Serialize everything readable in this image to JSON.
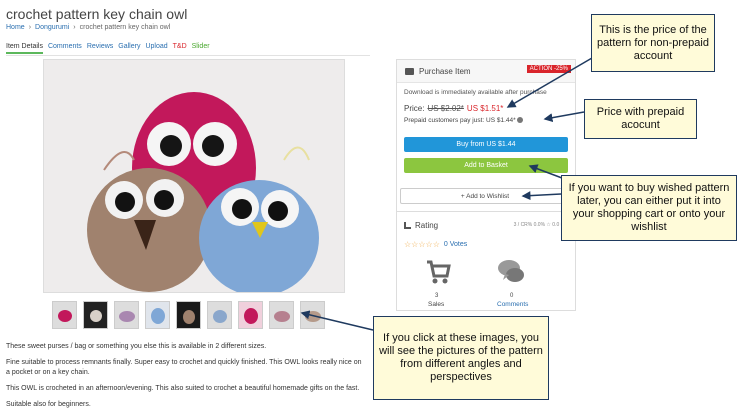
{
  "header": {
    "title": "crochet pattern key chain owl",
    "breadcrumb": [
      "Home",
      "Dongurumi",
      "crochet pattern key chain owl"
    ],
    "breadcrumb_sep": "›"
  },
  "tabs": [
    {
      "label": "Item Details"
    },
    {
      "label": "Comments"
    },
    {
      "label": "Reviews"
    },
    {
      "label": "Gallery"
    },
    {
      "label": "Upload"
    },
    {
      "label": "T&D"
    },
    {
      "label": "Slider"
    }
  ],
  "purchase": {
    "heading": "Purchase Item",
    "badge": "ACTION -25%",
    "download_note": "Download is immediately available after purchase",
    "price_label": "Price:",
    "old_price": "US $2.02*",
    "new_price": "US $1.51*",
    "prepaid_note": "Prepaid customers pay just: US $1.44*",
    "buy_button": "Buy from US $1.44",
    "basket_button": "Add to Basket",
    "wishlist_button": "+ Add to Wishlist"
  },
  "rating": {
    "heading": "Rating",
    "stats": "3 / CR% 0.0%  ☆ 0.0  ✉ 0",
    "stars": "☆☆☆☆☆",
    "votes": "0 Votes",
    "sales_count": "3",
    "sales_label": "Sales",
    "comments_count": "0",
    "comments_label": "Comments"
  },
  "description": [
    "These sweet purses / bag or something you else this is available in 2 different sizes.",
    "Fine suitable to process remnants finally. Super easy to crochet and quickly finished. This OWL looks really nice on a pocket or on a key chain.",
    "This OWL is crocheted in an afternoon/evening. This also suited to crochet a beautiful homemade gifts on the fast.",
    "Suitable also for beginners."
  ],
  "callouts": {
    "c1": "This is the price of the pattern for non-prepaid account",
    "c2": "Price with prepaid acocunt",
    "c3": "If you want to buy wished pattern later, you can either put it into your shopping cart or onto your wishlist",
    "c4": "If you click at these images, you will see the pictures of the pattern from different angles and perspectives"
  },
  "colors": {
    "buy": "#2196d9",
    "basket": "#8cc63f",
    "action_badge": "#d9252b",
    "callout_bg": "#fffbd9",
    "callout_border": "#1f3a5f"
  },
  "icons": [
    "cart-icon",
    "info-icon",
    "bars-icon",
    "shopping-cart-icon",
    "speech-bubble-icon"
  ]
}
